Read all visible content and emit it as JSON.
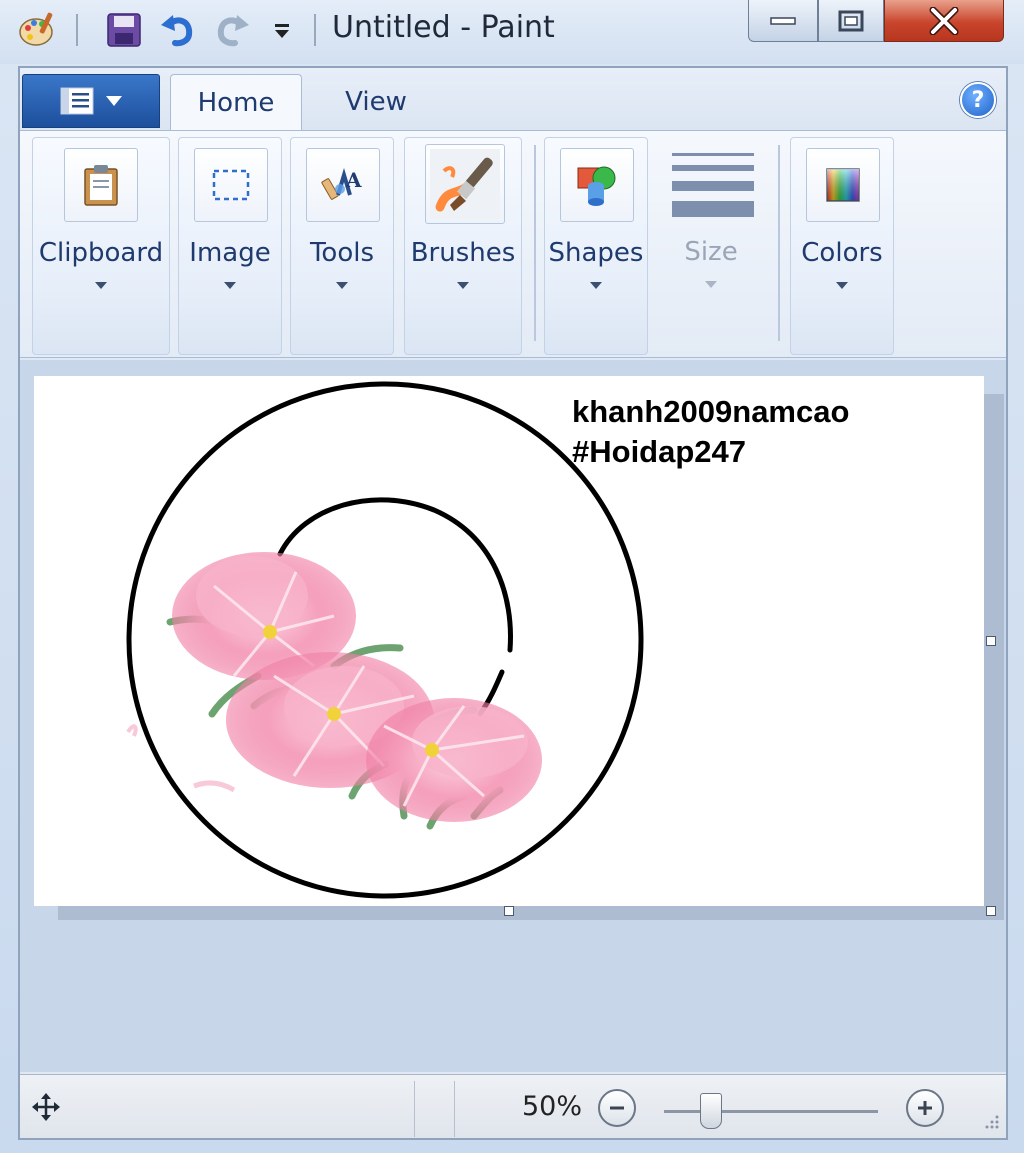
{
  "window": {
    "title": "Untitled - Paint"
  },
  "ribbon_tabs": [
    {
      "label": "Home",
      "active": true
    },
    {
      "label": "View",
      "active": false
    }
  ],
  "help": {
    "label": "?"
  },
  "groups": [
    {
      "label": "Clipboard",
      "icon": "clipboard-icon"
    },
    {
      "label": "Image",
      "icon": "select-rectangle-icon"
    },
    {
      "label": "Tools",
      "icon": "tools-icon"
    },
    {
      "label": "Brushes",
      "icon": "brush-icon"
    },
    {
      "label": "Shapes",
      "icon": "shapes-icon"
    },
    {
      "label": "Size",
      "icon": "line-size-icon",
      "disabled": true
    },
    {
      "label": "Colors",
      "icon": "color-palette-icon"
    }
  ],
  "canvas": {
    "text_lines": [
      "khanh2009namcao",
      "#Hoidap247"
    ]
  },
  "status": {
    "zoom_label": "50%",
    "zoom_level": 0.5
  },
  "colors": {
    "accent": "#1d4f9c",
    "flower_pink": "#f49ab8",
    "leaf_green": "#5e9a62"
  }
}
